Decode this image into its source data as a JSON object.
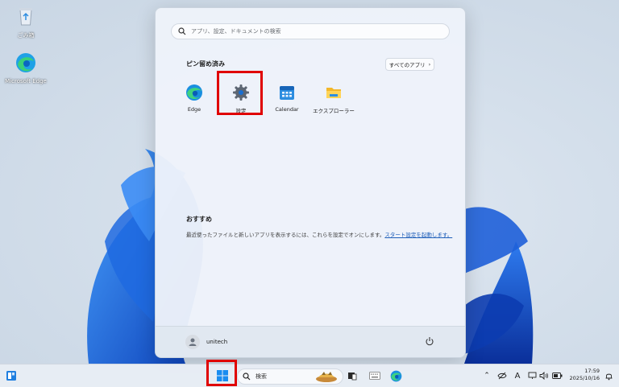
{
  "desktop": {
    "icons": [
      {
        "label": "ごみ箱",
        "icon": "recycle-bin-icon"
      },
      {
        "label": "Microsoft Edge",
        "icon": "edge-icon"
      }
    ]
  },
  "start_menu": {
    "search_placeholder": "アプリ、設定、ドキュメントの検索",
    "pinned_title": "ピン留め済み",
    "all_apps_label": "すべてのアプリ",
    "pinned_apps": [
      {
        "label": "Edge",
        "icon": "edge-icon"
      },
      {
        "label": "設定",
        "icon": "settings-gear-icon"
      },
      {
        "label": "Calendar",
        "icon": "calendar-icon"
      },
      {
        "label": "エクスプローラー",
        "icon": "folder-icon"
      }
    ],
    "recommended_title": "おすすめ",
    "recommended_text": "最近使ったファイルと新しいアプリを表示するには、これらを設定でオンにします。",
    "recommended_link": "スタート設定を起動します。",
    "user_name": "unitech"
  },
  "taskbar": {
    "search_label": "検索",
    "ime_label": "A",
    "time": "17:59",
    "date": "2025/10/16"
  },
  "colors": {
    "accent": "#0f6cbd",
    "highlight": "#e00000"
  }
}
